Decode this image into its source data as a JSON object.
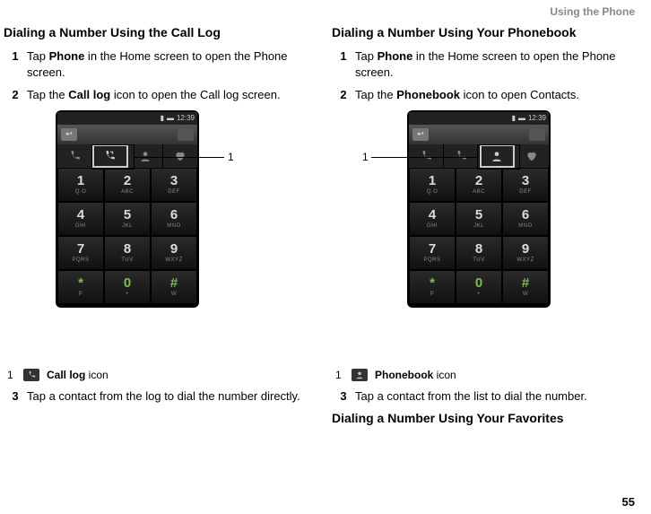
{
  "header": {
    "section": "Using the Phone"
  },
  "page_number": "55",
  "left": {
    "title": "Dialing a Number Using the Call Log",
    "steps": {
      "s1": {
        "n": "1",
        "pre": "Tap ",
        "bold": "Phone",
        "post": " in the Home screen to open the Phone screen."
      },
      "s2": {
        "n": "2",
        "pre": "Tap the ",
        "bold": "Call log",
        "post": " icon to open the Call log screen."
      },
      "s3": {
        "n": "3",
        "text": "Tap a contact from the log to dial the number directly."
      }
    },
    "callout": "1",
    "legend": {
      "n": "1",
      "bold": "Call log",
      "post": " icon"
    }
  },
  "right": {
    "title": "Dialing a Number Using Your Phonebook",
    "steps": {
      "s1": {
        "n": "1",
        "pre": "Tap ",
        "bold": "Phone",
        "post": " in the Home screen to open the Phone screen."
      },
      "s2": {
        "n": "2",
        "pre": "Tap the ",
        "bold": "Phonebook",
        "post": " icon to open Contacts."
      },
      "s3": {
        "n": "3",
        "text": "Tap a contact from the list to dial the number."
      }
    },
    "callout": "1",
    "legend": {
      "n": "1",
      "bold": "Phonebook",
      "post": " icon"
    },
    "title2": "Dialing a Number Using Your Favorites"
  },
  "phone": {
    "time": "12:39",
    "keys": [
      {
        "big": "1",
        "sm": "Q.O"
      },
      {
        "big": "2",
        "sm": "ABC"
      },
      {
        "big": "3",
        "sm": "DEF"
      },
      {
        "big": "4",
        "sm": "GHI"
      },
      {
        "big": "5",
        "sm": "JKL"
      },
      {
        "big": "6",
        "sm": "MNO"
      },
      {
        "big": "7",
        "sm": "PQRS"
      },
      {
        "big": "8",
        "sm": "TUV"
      },
      {
        "big": "9",
        "sm": "WXYZ"
      },
      {
        "big": "*",
        "sm": "P"
      },
      {
        "big": "0",
        "sm": "+"
      },
      {
        "big": "#",
        "sm": "W"
      }
    ]
  }
}
